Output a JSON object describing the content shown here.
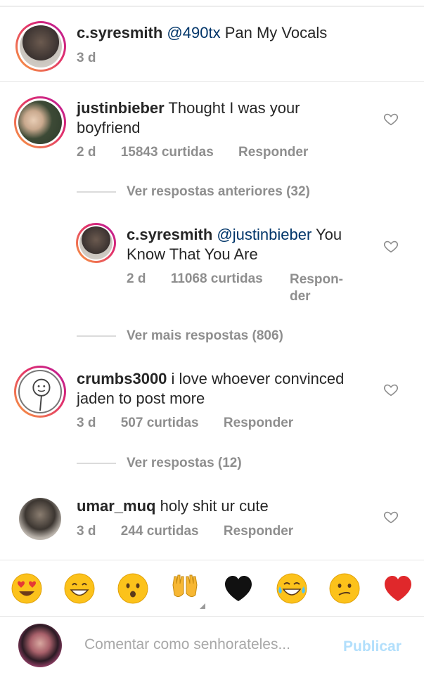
{
  "caption": {
    "username": "c.syresmith",
    "mention": "@490tx",
    "text": "Pan My Vocals",
    "time": "3 d"
  },
  "comments": [
    {
      "username": "justinbieber",
      "text_line1": "Thought I was your",
      "text_line2": "boyfriend",
      "time": "2 d",
      "likes": "15843 curtidas",
      "reply": "Responder",
      "view_replies": "Ver respostas anteriores (32)"
    },
    {
      "username": "c.syresmith",
      "mention": "@justinbieber",
      "text_line1": "You",
      "text_line2": "Know That You Are",
      "time": "2 d",
      "likes": "11068 curtidas",
      "reply_line1": "Respon-",
      "reply_line2": "der",
      "view_more": "Ver mais respostas (806)"
    },
    {
      "username": "crumbs3000",
      "text_line1": "i love whoever convinced",
      "text_line2": "jaden to post more",
      "time": "3 d",
      "likes": "507 curtidas",
      "reply": "Responder",
      "view_replies": "Ver respostas (12)"
    },
    {
      "username": "umar_muq",
      "text_line1": "holy shit ur cute",
      "time": "3 d",
      "likes": "244 curtidas",
      "reply": "Responder"
    }
  ],
  "emojis": [
    "heart-eyes",
    "grinning",
    "hushed",
    "raising-hands",
    "black-heart",
    "tears-of-joy",
    "confused",
    "red-heart"
  ],
  "composer": {
    "placeholder": "Comentar como senhorateles...",
    "publish": "Publicar"
  },
  "colors": {
    "mention": "#003569",
    "secondary": "#8e8e8e",
    "publish": "#b2dffc"
  }
}
